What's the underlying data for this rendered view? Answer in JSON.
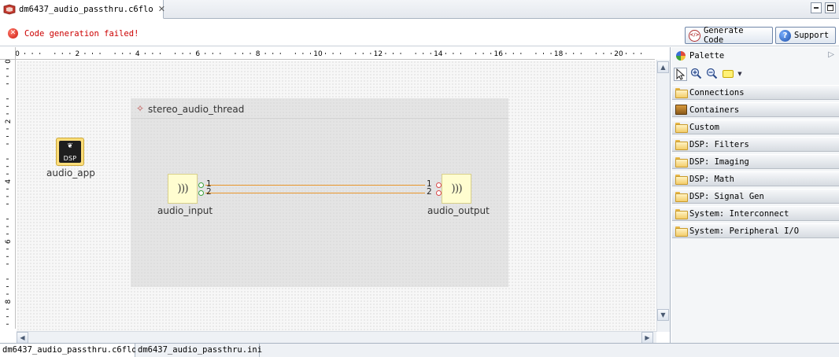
{
  "tabs": {
    "editor_tab": "dm6437_audio_passthru.c6flo",
    "close_glyph": "✕"
  },
  "status": {
    "message": "Code generation failed!",
    "error_glyph": "✕",
    "generate_label": "Generate Code",
    "support_label": "Support",
    "support_glyph": "?"
  },
  "ruler": {
    "h_labels": [
      "0",
      "2",
      "4",
      "6",
      "8",
      "10",
      "12",
      "14",
      "16",
      "18",
      "20"
    ],
    "v_labels": [
      "0",
      "2",
      "4",
      "6",
      "8"
    ]
  },
  "diagram": {
    "thread_title": "stereo_audio_thread",
    "thread_icon": "✧",
    "app_label": "audio_app",
    "app_chip": "DSP",
    "app_logo": "❦",
    "input_label": "audio_input",
    "output_label": "audio_output",
    "io_glyph": ")))",
    "output_io_glyph": "((("
  },
  "bottom_tabs": [
    "dm6437_audio_passthru.c6flo",
    "dm6437_audio_passthru.ini"
  ],
  "palette": {
    "title": "Palette",
    "collapse_glyph": "▷",
    "drawers": [
      {
        "label": "Connections",
        "icon": "folder-icon"
      },
      {
        "label": "Containers",
        "icon": "box-icon"
      },
      {
        "label": "Custom",
        "icon": "folder-icon"
      },
      {
        "label": "DSP: Filters",
        "icon": "folder-icon"
      },
      {
        "label": "DSP: Imaging",
        "icon": "folder-icon"
      },
      {
        "label": "DSP: Math",
        "icon": "folder-icon"
      },
      {
        "label": "DSP: Signal Gen",
        "icon": "folder-icon"
      },
      {
        "label": "System: Interconnect",
        "icon": "folder-icon"
      },
      {
        "label": "System: Peripheral I/O",
        "icon": "folder-icon"
      }
    ]
  },
  "colors": {
    "error": "#cc0000",
    "wire": "#e8952a",
    "port_out": "#3aa13a",
    "port_in": "#d94848",
    "io_block": "#fffdd0"
  }
}
